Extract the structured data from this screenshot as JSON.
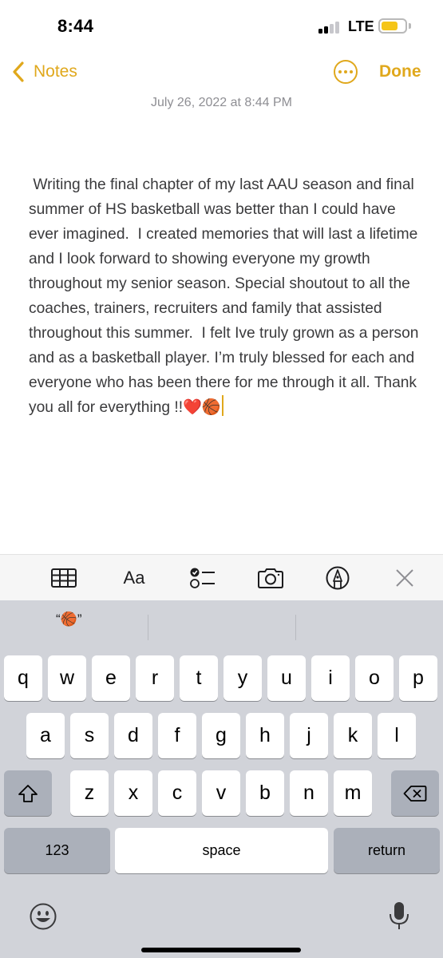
{
  "status": {
    "time": "8:44",
    "network": "LTE"
  },
  "nav": {
    "back_label": "Notes",
    "done_label": "Done",
    "more_icon": "ellipsis-circle-icon"
  },
  "note": {
    "date": "July 26, 2022 at 8:44 PM",
    "body": " Writing the final chapter of my last AAU season and final summer of HS basketball was better than I could have ever imagined.  I created memories that will last a lifetime and I look forward to showing everyone my growth throughout my senior season. Special shoutout to all the coaches, trainers, recruiters and family that assisted throughout this summer.  I felt Ive truly grown as a person and as a basketball player. I’m truly blessed for each and everyone who has been there for me through it all. Thank you all for everything !!❤️🏀"
  },
  "toolbar": {
    "format_label": "Aa",
    "icons": [
      "table-icon",
      "format-icon",
      "checklist-icon",
      "camera-icon",
      "markup-icon",
      "close-icon"
    ]
  },
  "keyboard": {
    "prediction": "“🏀”",
    "row1": [
      "q",
      "w",
      "e",
      "r",
      "t",
      "y",
      "u",
      "i",
      "o",
      "p"
    ],
    "row2": [
      "a",
      "s",
      "d",
      "f",
      "g",
      "h",
      "j",
      "k",
      "l"
    ],
    "row3": [
      "z",
      "x",
      "c",
      "v",
      "b",
      "n",
      "m"
    ],
    "numbers_label": "123",
    "space_label": "space",
    "return_label": "return",
    "icons": [
      "shift-icon",
      "delete-icon",
      "emoji-icon",
      "microphone-icon"
    ]
  },
  "colors": {
    "accent": "#e0a81c",
    "battery": "#f5c518",
    "keyboard_bg": "#d1d3d9"
  }
}
